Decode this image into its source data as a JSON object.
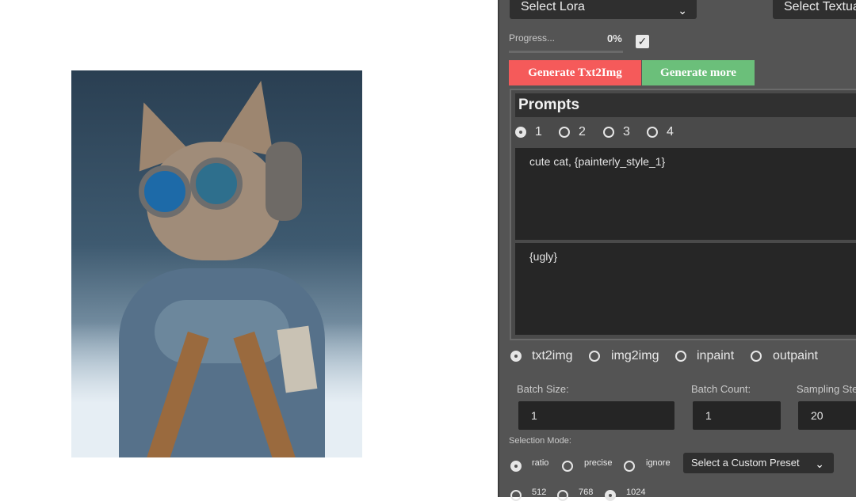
{
  "image": {
    "subject_icon": "cat-photo"
  },
  "top": {
    "lora_select": "Select Lora",
    "textual_select": "Select Textual"
  },
  "progress": {
    "label": "Progress...",
    "value_text": "0%",
    "value": 0,
    "checked": true
  },
  "buttons": {
    "generate": "Generate Txt2Img",
    "generate_more": "Generate more",
    "generate_color": "#f55a5a",
    "more_color": "#6bbf7a"
  },
  "prompts": {
    "title": "Prompts",
    "tabs": [
      "1",
      "2",
      "3",
      "4"
    ],
    "selected_tab": "1",
    "positive": "cute cat, {painterly_style_1}",
    "negative": "{ugly}"
  },
  "modes": {
    "options": [
      "txt2img",
      "img2img",
      "inpaint",
      "outpaint"
    ],
    "selected": "txt2img"
  },
  "settings": {
    "batch_size_label": "Batch Size:",
    "batch_size": "1",
    "batch_count_label": "Batch Count:",
    "batch_count": "1",
    "sampling_steps_label": "Sampling Ste",
    "sampling_steps": "20"
  },
  "selection": {
    "label": "Selection Mode:",
    "options": [
      "ratio",
      "precise",
      "ignore"
    ],
    "selected": "ratio",
    "preset": "Select a Custom Preset"
  },
  "sizes": {
    "options": [
      "512",
      "768",
      "1024"
    ],
    "selected": "1024"
  }
}
